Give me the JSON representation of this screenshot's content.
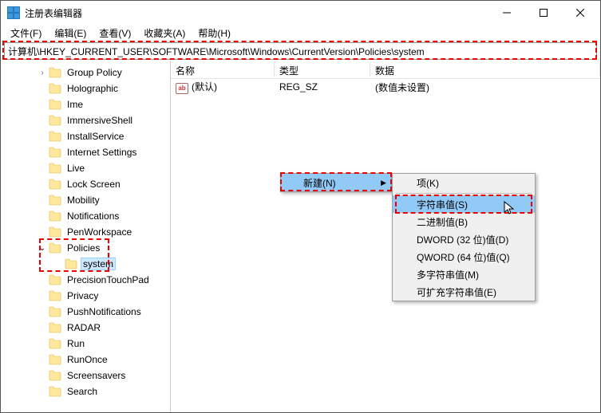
{
  "window": {
    "title": "注册表编辑器"
  },
  "menubar": {
    "file": "文件(F)",
    "edit": "编辑(E)",
    "view": "查看(V)",
    "favorites": "收藏夹(A)",
    "help": "帮助(H)"
  },
  "addressbar": {
    "path": "计算机\\HKEY_CURRENT_USER\\SOFTWARE\\Microsoft\\Windows\\CurrentVersion\\Policies\\system"
  },
  "tree": {
    "items": [
      {
        "label": "Group Policy",
        "indent": 60,
        "exp": ">"
      },
      {
        "label": "Holographic",
        "indent": 60,
        "exp": ""
      },
      {
        "label": "Ime",
        "indent": 60,
        "exp": ""
      },
      {
        "label": "ImmersiveShell",
        "indent": 60,
        "exp": ""
      },
      {
        "label": "InstallService",
        "indent": 60,
        "exp": ""
      },
      {
        "label": "Internet Settings",
        "indent": 60,
        "exp": ""
      },
      {
        "label": "Live",
        "indent": 60,
        "exp": ""
      },
      {
        "label": "Lock Screen",
        "indent": 60,
        "exp": ""
      },
      {
        "label": "Mobility",
        "indent": 60,
        "exp": ""
      },
      {
        "label": "Notifications",
        "indent": 60,
        "exp": ""
      },
      {
        "label": "PenWorkspace",
        "indent": 60,
        "exp": ""
      },
      {
        "label": "Policies",
        "indent": 60,
        "exp": "v"
      },
      {
        "label": "system",
        "indent": 80,
        "exp": "",
        "selected": true
      },
      {
        "label": "PrecisionTouchPad",
        "indent": 60,
        "exp": ""
      },
      {
        "label": "Privacy",
        "indent": 60,
        "exp": ""
      },
      {
        "label": "PushNotifications",
        "indent": 60,
        "exp": ""
      },
      {
        "label": "RADAR",
        "indent": 60,
        "exp": ""
      },
      {
        "label": "Run",
        "indent": 60,
        "exp": ""
      },
      {
        "label": "RunOnce",
        "indent": 60,
        "exp": ""
      },
      {
        "label": "Screensavers",
        "indent": 60,
        "exp": ""
      },
      {
        "label": "Search",
        "indent": 60,
        "exp": ""
      }
    ]
  },
  "list": {
    "cols": {
      "name": "名称",
      "type": "类型",
      "data": "数据"
    },
    "rows": [
      {
        "name": "(默认)",
        "type": "REG_SZ",
        "data": "(数值未设置)"
      }
    ]
  },
  "contextmenu1": {
    "new": "新建(N)"
  },
  "contextmenu2": {
    "items": [
      "项(K)",
      "字符串值(S)",
      "二进制值(B)",
      "DWORD (32 位)值(D)",
      "QWORD (64 位)值(Q)",
      "多字符串值(M)",
      "可扩充字符串值(E)"
    ]
  }
}
